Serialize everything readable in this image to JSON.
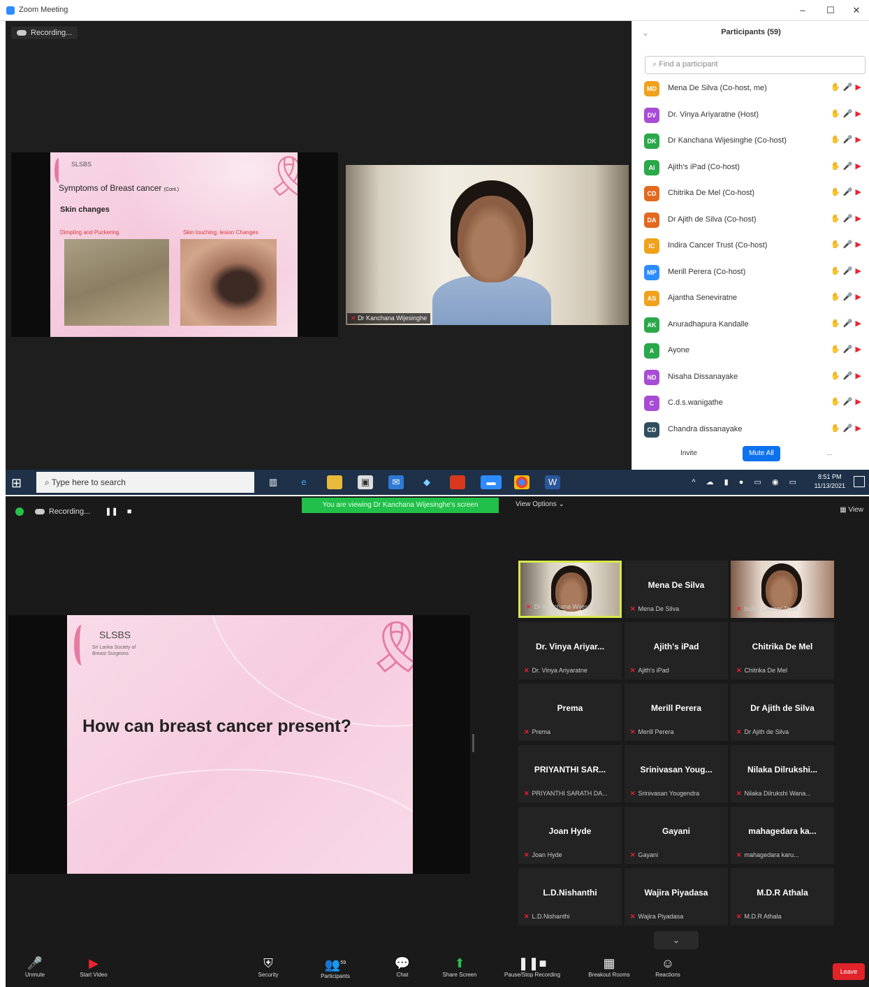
{
  "window": {
    "title": "Zoom Meeting",
    "minimize": "–",
    "maximize": "☐",
    "close": "✕"
  },
  "recording": {
    "label": "Recording..."
  },
  "slide1": {
    "logo": "SLSBS",
    "heading": "Symptoms of Breast cancer",
    "heading_suffix": "(Cont.)",
    "sub": "Skin changes",
    "caption_left": "Dimpling and Puckering",
    "caption_right": "Skin touching, lesion Changes"
  },
  "camera1": {
    "name": "Dr Kanchana Wijesinghe"
  },
  "participants_panel": {
    "title": "Participants (59)",
    "search_placeholder": "Find a participant",
    "items": [
      {
        "initials": "MD",
        "name": "Mena De Silva (Co-host, me)",
        "color": "#f0a21c"
      },
      {
        "initials": "DV",
        "name": "Dr. Vinya Ariyaratne (Host)",
        "color": "#a84cd6"
      },
      {
        "initials": "DK",
        "name": "Dr Kanchana Wijesinghe (Co-host)",
        "color": "#2aa84a"
      },
      {
        "initials": "AI",
        "name": "Ajith's iPad (Co-host)",
        "color": "#2aa84a"
      },
      {
        "initials": "CD",
        "name": "Chitrika De Mel (Co-host)",
        "color": "#e2691f"
      },
      {
        "initials": "DA",
        "name": "Dr Ajith de Silva (Co-host)",
        "color": "#e2691f"
      },
      {
        "initials": "IC",
        "name": "Indira Cancer Trust (Co-host)",
        "color": "#f0a21c"
      },
      {
        "initials": "MP",
        "name": "Merill Perera (Co-host)",
        "color": "#2d8cff"
      },
      {
        "initials": "AS",
        "name": "Ajantha Seneviratne",
        "color": "#f0a21c"
      },
      {
        "initials": "AK",
        "name": "Anuradhapura Kandalle",
        "color": "#2aa84a"
      },
      {
        "initials": "A",
        "name": "Ayone",
        "color": "#2aa84a"
      },
      {
        "initials": "ND",
        "name": "Nisaha Dissanayake",
        "color": "#a84cd6"
      },
      {
        "initials": "C",
        "name": "C.d.s.wanigathe",
        "color": "#a84cd6"
      },
      {
        "initials": "CD",
        "name": "Chandra dissanayake",
        "color": "#2f4f5f"
      }
    ],
    "invite": "Invite",
    "mute_all": "Mute All",
    "more": "..."
  },
  "taskbar": {
    "search": "Type here to search",
    "time": "8:51 PM",
    "date": "11/13/2021"
  },
  "meeting2": {
    "viewing_banner": "You are viewing Dr Kanchana Wijesinghe's screen",
    "view_options": "View Options ⌄",
    "view": "View",
    "slide": {
      "logo": "SLSBS",
      "logo_sub": "Sri Lanka Society of Breast Surgeons",
      "question": "How can breast cancer present?"
    },
    "tiles": [
      {
        "name": "",
        "sub": "Dr Kanchana Wijesinghe",
        "video": "vid",
        "active": true
      },
      {
        "name": "Mena De Silva",
        "sub": "Mena De Silva",
        "video": ""
      },
      {
        "name": "",
        "sub": "Indira Cancer Trust",
        "video": "vid2"
      },
      {
        "name": "Dr. Vinya Ariyar...",
        "sub": "Dr. Vinya Ariyaratne",
        "video": ""
      },
      {
        "name": "Ajith's iPad",
        "sub": "Ajith's iPad",
        "video": ""
      },
      {
        "name": "Chitrika De Mel",
        "sub": "Chitrika De Mel",
        "video": ""
      },
      {
        "name": "Prema",
        "sub": "Prema",
        "video": ""
      },
      {
        "name": "Merill Perera",
        "sub": "Merill Perera",
        "video": ""
      },
      {
        "name": "Dr Ajith de Silva",
        "sub": "Dr Ajith de Silva",
        "video": ""
      },
      {
        "name": "PRIYANTHI SAR...",
        "sub": "PRIYANTHI SARATH DA...",
        "video": ""
      },
      {
        "name": "Srinivasan Youg...",
        "sub": "Srinivasan Yougendra",
        "video": ""
      },
      {
        "name": "Nilaka Dilrukshi...",
        "sub": "Nilaka Dilrukshi Wana...",
        "video": ""
      },
      {
        "name": "Joan Hyde",
        "sub": "Joan Hyde",
        "video": ""
      },
      {
        "name": "Gayani",
        "sub": "Gayani",
        "video": ""
      },
      {
        "name": "mahagedara ka...",
        "sub": "mahagedara karu...",
        "video": ""
      },
      {
        "name": "L.D.Nishanthi",
        "sub": "L.D.Nishanthi",
        "video": ""
      },
      {
        "name": "Wajira Piyadasa",
        "sub": "Wajira Piyadasa",
        "video": ""
      },
      {
        "name": "M.D.R Athala",
        "sub": "M.D.R Athala",
        "video": ""
      }
    ],
    "toolbar": {
      "unmute": "Unmute",
      "start_video": "Start Video",
      "security": "Security",
      "participants": "Participants",
      "participants_count": "59",
      "chat": "Chat",
      "share_screen": "Share Screen",
      "pause_recording": "Pause/Stop Recording",
      "breakout": "Breakout Rooms",
      "reactions": "Reactions",
      "leave": "Leave"
    }
  }
}
